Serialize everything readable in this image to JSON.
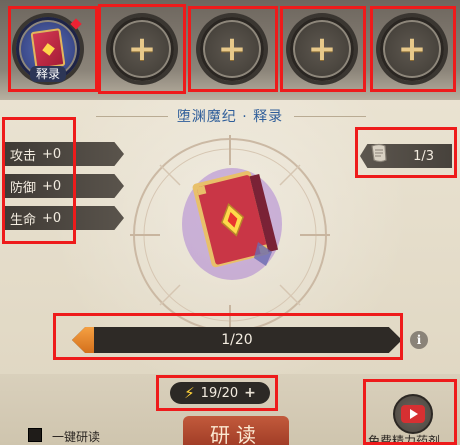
{
  "slots": {
    "active": {
      "label": "释录",
      "icon": "book-icon"
    },
    "empty_label": "+"
  },
  "title": "堕渊魔纪 · 释录",
  "stats": [
    {
      "name": "攻击",
      "value": "+0"
    },
    {
      "name": "防御",
      "value": "+0"
    },
    {
      "name": "生命",
      "value": "+0"
    }
  ],
  "pages": "1/3",
  "progress": {
    "label": "1/20",
    "fraction": 0.05
  },
  "energy": {
    "value": "19/20",
    "plus": "+"
  },
  "one_click_label": "一键研读",
  "study_button": "研读",
  "free_potion_label": "免费精力药剂",
  "colors": {
    "accent": "#ee1b1b",
    "progress": "#f5a042"
  }
}
